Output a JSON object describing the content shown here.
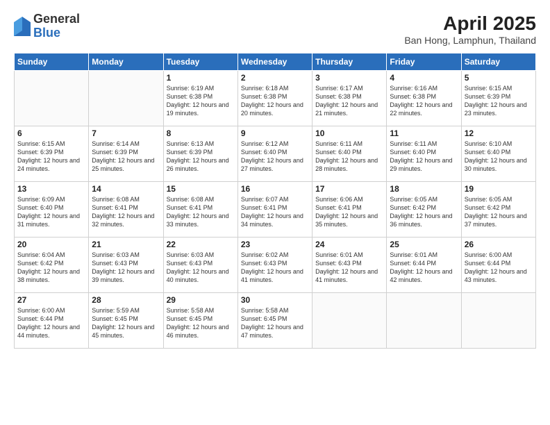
{
  "logo": {
    "general": "General",
    "blue": "Blue"
  },
  "title": "April 2025",
  "subtitle": "Ban Hong, Lamphun, Thailand",
  "days_of_week": [
    "Sunday",
    "Monday",
    "Tuesday",
    "Wednesday",
    "Thursday",
    "Friday",
    "Saturday"
  ],
  "weeks": [
    [
      {
        "day": "",
        "info": ""
      },
      {
        "day": "",
        "info": ""
      },
      {
        "day": "1",
        "info": "Sunrise: 6:19 AM\nSunset: 6:38 PM\nDaylight: 12 hours and 19 minutes."
      },
      {
        "day": "2",
        "info": "Sunrise: 6:18 AM\nSunset: 6:38 PM\nDaylight: 12 hours and 20 minutes."
      },
      {
        "day": "3",
        "info": "Sunrise: 6:17 AM\nSunset: 6:38 PM\nDaylight: 12 hours and 21 minutes."
      },
      {
        "day": "4",
        "info": "Sunrise: 6:16 AM\nSunset: 6:38 PM\nDaylight: 12 hours and 22 minutes."
      },
      {
        "day": "5",
        "info": "Sunrise: 6:15 AM\nSunset: 6:39 PM\nDaylight: 12 hours and 23 minutes."
      }
    ],
    [
      {
        "day": "6",
        "info": "Sunrise: 6:15 AM\nSunset: 6:39 PM\nDaylight: 12 hours and 24 minutes."
      },
      {
        "day": "7",
        "info": "Sunrise: 6:14 AM\nSunset: 6:39 PM\nDaylight: 12 hours and 25 minutes."
      },
      {
        "day": "8",
        "info": "Sunrise: 6:13 AM\nSunset: 6:39 PM\nDaylight: 12 hours and 26 minutes."
      },
      {
        "day": "9",
        "info": "Sunrise: 6:12 AM\nSunset: 6:40 PM\nDaylight: 12 hours and 27 minutes."
      },
      {
        "day": "10",
        "info": "Sunrise: 6:11 AM\nSunset: 6:40 PM\nDaylight: 12 hours and 28 minutes."
      },
      {
        "day": "11",
        "info": "Sunrise: 6:11 AM\nSunset: 6:40 PM\nDaylight: 12 hours and 29 minutes."
      },
      {
        "day": "12",
        "info": "Sunrise: 6:10 AM\nSunset: 6:40 PM\nDaylight: 12 hours and 30 minutes."
      }
    ],
    [
      {
        "day": "13",
        "info": "Sunrise: 6:09 AM\nSunset: 6:40 PM\nDaylight: 12 hours and 31 minutes."
      },
      {
        "day": "14",
        "info": "Sunrise: 6:08 AM\nSunset: 6:41 PM\nDaylight: 12 hours and 32 minutes."
      },
      {
        "day": "15",
        "info": "Sunrise: 6:08 AM\nSunset: 6:41 PM\nDaylight: 12 hours and 33 minutes."
      },
      {
        "day": "16",
        "info": "Sunrise: 6:07 AM\nSunset: 6:41 PM\nDaylight: 12 hours and 34 minutes."
      },
      {
        "day": "17",
        "info": "Sunrise: 6:06 AM\nSunset: 6:41 PM\nDaylight: 12 hours and 35 minutes."
      },
      {
        "day": "18",
        "info": "Sunrise: 6:05 AM\nSunset: 6:42 PM\nDaylight: 12 hours and 36 minutes."
      },
      {
        "day": "19",
        "info": "Sunrise: 6:05 AM\nSunset: 6:42 PM\nDaylight: 12 hours and 37 minutes."
      }
    ],
    [
      {
        "day": "20",
        "info": "Sunrise: 6:04 AM\nSunset: 6:42 PM\nDaylight: 12 hours and 38 minutes."
      },
      {
        "day": "21",
        "info": "Sunrise: 6:03 AM\nSunset: 6:43 PM\nDaylight: 12 hours and 39 minutes."
      },
      {
        "day": "22",
        "info": "Sunrise: 6:03 AM\nSunset: 6:43 PM\nDaylight: 12 hours and 40 minutes."
      },
      {
        "day": "23",
        "info": "Sunrise: 6:02 AM\nSunset: 6:43 PM\nDaylight: 12 hours and 41 minutes."
      },
      {
        "day": "24",
        "info": "Sunrise: 6:01 AM\nSunset: 6:43 PM\nDaylight: 12 hours and 41 minutes."
      },
      {
        "day": "25",
        "info": "Sunrise: 6:01 AM\nSunset: 6:44 PM\nDaylight: 12 hours and 42 minutes."
      },
      {
        "day": "26",
        "info": "Sunrise: 6:00 AM\nSunset: 6:44 PM\nDaylight: 12 hours and 43 minutes."
      }
    ],
    [
      {
        "day": "27",
        "info": "Sunrise: 6:00 AM\nSunset: 6:44 PM\nDaylight: 12 hours and 44 minutes."
      },
      {
        "day": "28",
        "info": "Sunrise: 5:59 AM\nSunset: 6:45 PM\nDaylight: 12 hours and 45 minutes."
      },
      {
        "day": "29",
        "info": "Sunrise: 5:58 AM\nSunset: 6:45 PM\nDaylight: 12 hours and 46 minutes."
      },
      {
        "day": "30",
        "info": "Sunrise: 5:58 AM\nSunset: 6:45 PM\nDaylight: 12 hours and 47 minutes."
      },
      {
        "day": "",
        "info": ""
      },
      {
        "day": "",
        "info": ""
      },
      {
        "day": "",
        "info": ""
      }
    ]
  ]
}
